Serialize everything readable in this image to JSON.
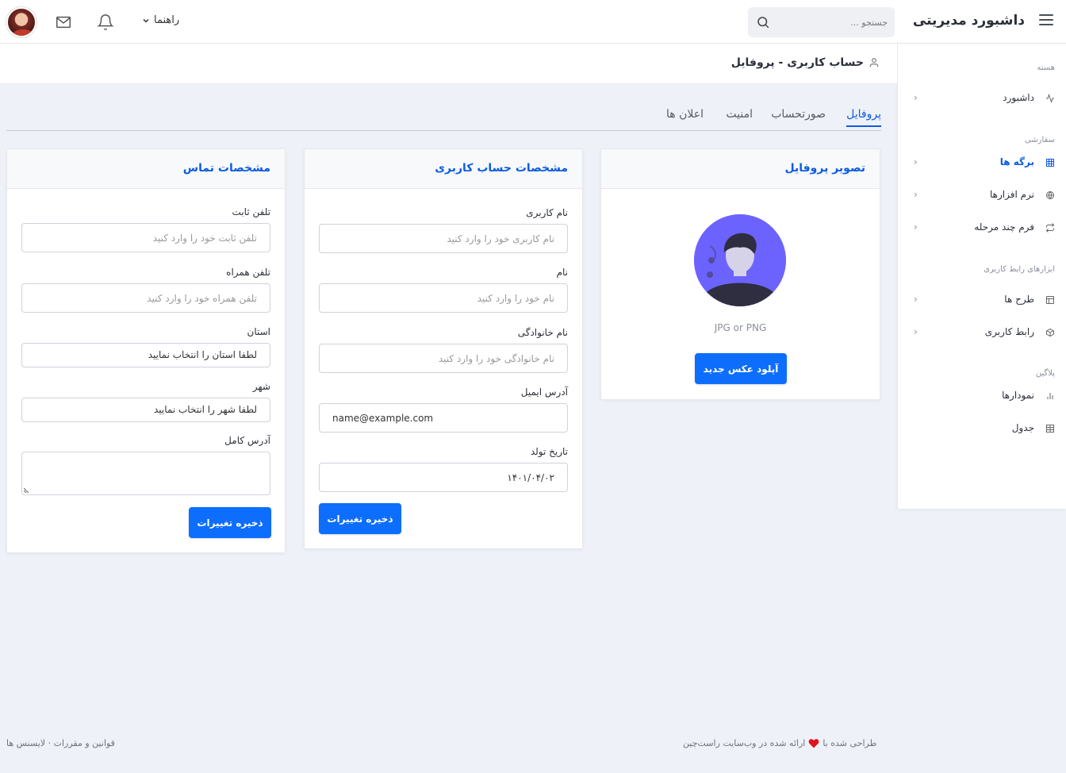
{
  "header": {
    "brand": "داشبورد مدیریتی",
    "search_placeholder": "جستجو ...",
    "guide_label": "راهنما"
  },
  "sidebar": {
    "sections": [
      {
        "heading": "هسته"
      },
      {
        "heading": "سفارشی"
      },
      {
        "heading": "ابزارهای رابط کاربری"
      },
      {
        "heading": "پلاگین"
      }
    ],
    "items": [
      {
        "label": "داشبورد",
        "icon": "activity-icon",
        "chevron": "‹"
      },
      {
        "label": "برگه ها",
        "icon": "grid-icon",
        "chevron": "‹",
        "active": true
      },
      {
        "label": "نرم افزارها",
        "icon": "globe-icon",
        "chevron": "‹"
      },
      {
        "label": "فرم چند مرحله",
        "icon": "repeat-icon",
        "chevron": "‹"
      },
      {
        "label": "طرح ها",
        "icon": "layout-icon",
        "chevron": "‹"
      },
      {
        "label": "رابط کاربری",
        "icon": "package-icon",
        "chevron": "‹"
      },
      {
        "label": "نمودارها",
        "icon": "bar-chart-icon"
      },
      {
        "label": "جدول",
        "icon": "table-icon"
      }
    ]
  },
  "page": {
    "title": "حساب کاربری - پروفایل"
  },
  "tabs": [
    {
      "label": "پروفایل",
      "active": true
    },
    {
      "label": "صورتحساب"
    },
    {
      "label": "امنیت"
    },
    {
      "label": "اعلان ها"
    }
  ],
  "profile_card": {
    "title": "تصویر پروفایل",
    "hint": "JPG or PNG",
    "upload_button": "آپلود عکس جدید"
  },
  "account_card": {
    "title": "مشخصات حساب کاربری",
    "fields": [
      {
        "label": "نام کاربری",
        "placeholder": "نام کاربری خود را وارد کنید",
        "value": ""
      },
      {
        "label": "نام",
        "placeholder": "نام خود را وارد کنید",
        "value": ""
      },
      {
        "label": "نام خانوادگی",
        "placeholder": "نام خانوادگی خود را وارد کنید",
        "value": ""
      },
      {
        "label": "آدرس ایمیل",
        "placeholder": "",
        "value": "name@example.com"
      },
      {
        "label": "تاریخ تولد",
        "placeholder": "",
        "value": "۱۴۰۱/۰۴/۰۲"
      }
    ],
    "save_button": "ذخیره تغییرات"
  },
  "contact_card": {
    "title": "مشخصات تماس",
    "phone_label": "تلفن ثابت",
    "phone_placeholder": "تلفن ثابت خود را وارد کنید",
    "mobile_label": "تلفن همراه",
    "mobile_placeholder": "تلفن همراه خود را وارد کنید",
    "province_label": "استان",
    "province_value": "لطفا استان را انتخاب نمایید",
    "city_label": "شهر",
    "city_value": "لطفا شهر را انتخاب نمایید",
    "address_label": "آدرس کامل",
    "save_button": "ذخیره تغییرات"
  },
  "footer": {
    "credit_before": "طراحی شده با",
    "credit_after": "ارائه شده در وب‌سایت راست‌چین",
    "links": "قوانین و مقررات · لایسنس ها"
  },
  "colors": {
    "accent": "#0d6efd",
    "link": "#0d5be1",
    "background": "#eef1f7",
    "avatar_bg": "#6c63ff"
  }
}
